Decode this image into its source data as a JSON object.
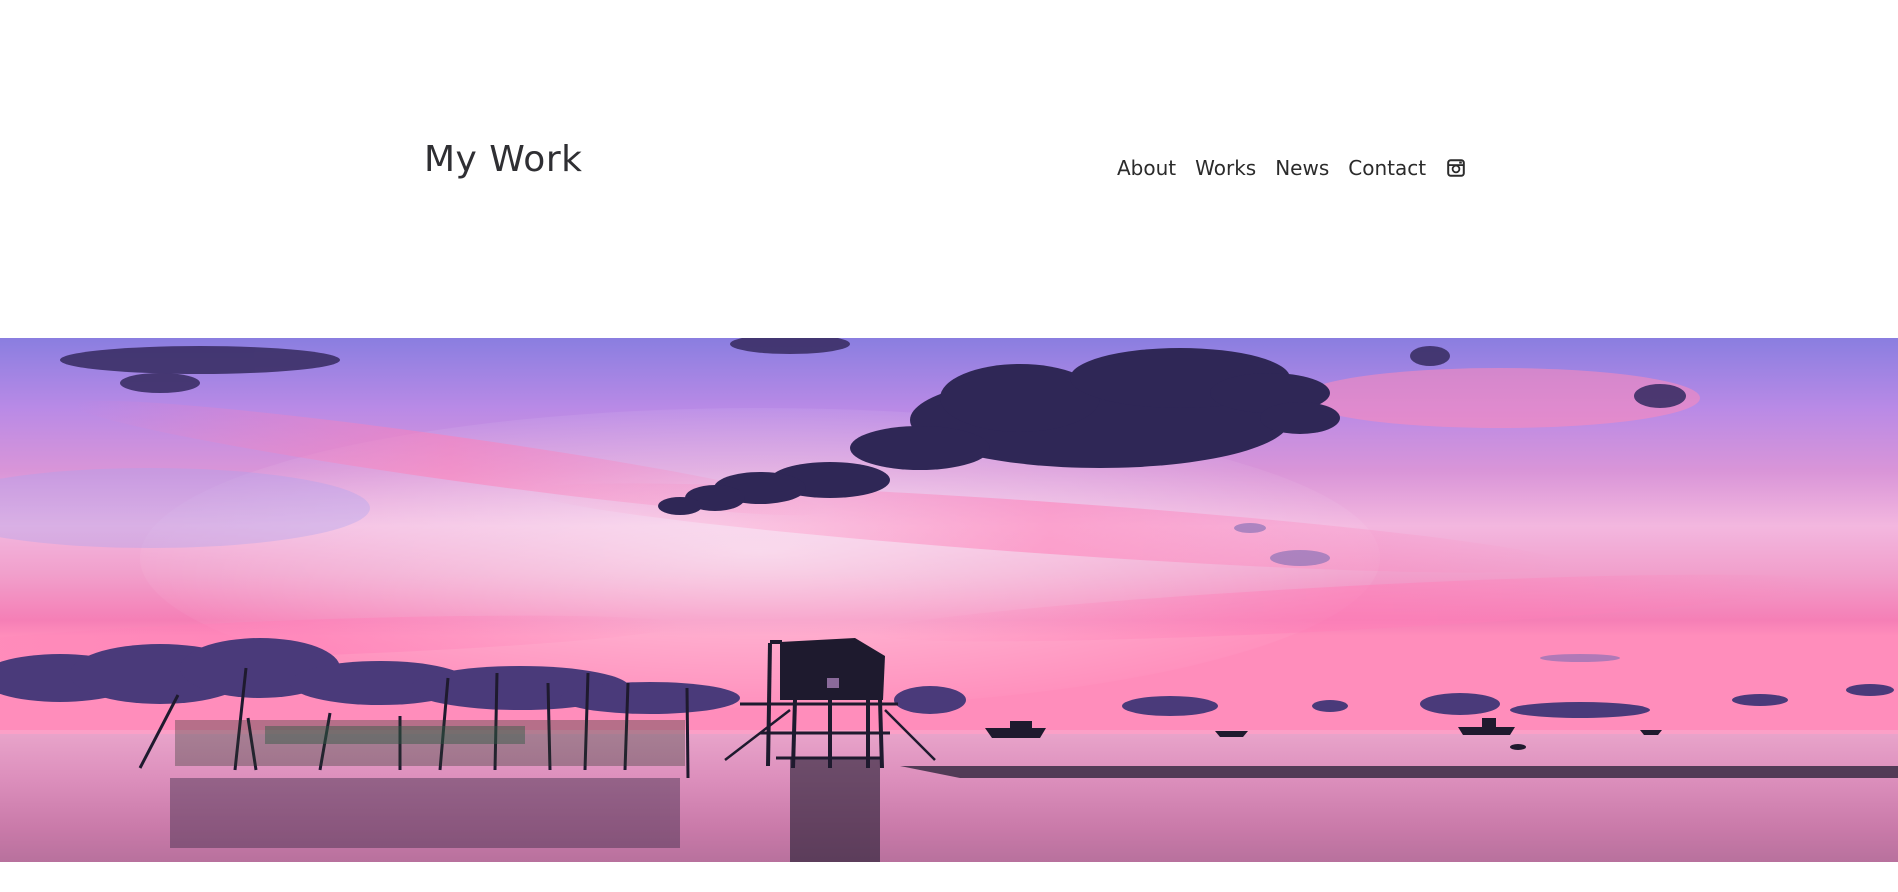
{
  "header": {
    "site_title": "My Work"
  },
  "nav": {
    "items": [
      {
        "label": "About"
      },
      {
        "label": "Works"
      },
      {
        "label": "News"
      },
      {
        "label": "Contact"
      }
    ],
    "social_icon": "instagram-icon"
  },
  "hero": {
    "image_subject": "sunset-seascape-with-stilt-hut",
    "colors": {
      "sky_top": "#8d83e6",
      "sky_pink": "#f28cc3",
      "horizon": "#ff8fb6",
      "water": "#d68db8",
      "silhouette": "#1e1a2e"
    }
  }
}
